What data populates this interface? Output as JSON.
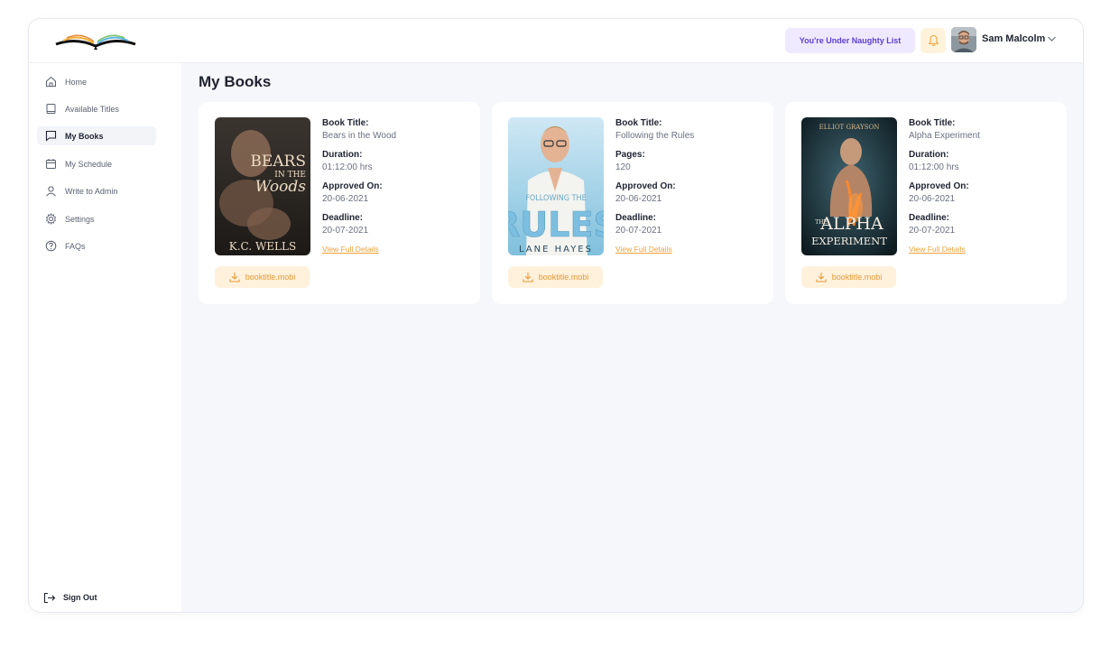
{
  "header": {
    "status_badge": "You're Under Naughty List",
    "user_name": "Sam Malcolm"
  },
  "sidebar": {
    "items": [
      {
        "label": "Home",
        "icon": "home-icon"
      },
      {
        "label": "Available Titles",
        "icon": "book-icon"
      },
      {
        "label": "My Books",
        "icon": "chat-icon",
        "active": true
      },
      {
        "label": "My Schedule",
        "icon": "calendar-icon"
      },
      {
        "label": "Write to Admin",
        "icon": "user-icon"
      },
      {
        "label": "Settings",
        "icon": "gear-icon"
      },
      {
        "label": "FAQs",
        "icon": "question-icon"
      }
    ],
    "sign_out": "Sign Out"
  },
  "main": {
    "title": "My Books",
    "books": [
      {
        "cover": {
          "line1": "BEARS",
          "line2": "IN THE",
          "line3": "Woods",
          "author": "K.C. WELLS"
        },
        "fields": [
          {
            "label": "Book Title:",
            "value": "Bears in the Wood"
          },
          {
            "label": "Duration:",
            "value": "01:12:00 hrs"
          },
          {
            "label": "Approved On:",
            "value": "20-06-2021"
          },
          {
            "label": "Deadline:",
            "value": "20-07-2021"
          }
        ],
        "link": "View Full Details",
        "file": "booktitle.mobi"
      },
      {
        "cover": {
          "line1": "FOLLOWING THE",
          "line2": "RULES",
          "author": "LANE HAYES"
        },
        "fields": [
          {
            "label": "Book Title:",
            "value": "Following the Rules"
          },
          {
            "label": "Pages:",
            "value": "120"
          },
          {
            "label": "Approved On:",
            "value": "20-06-2021"
          },
          {
            "label": "Deadline:",
            "value": "20-07-2021"
          }
        ],
        "link": "View Full Details",
        "file": "booktitle.mobi"
      },
      {
        "cover": {
          "line0": "ELLIOT GRAYSON",
          "line1": "THE",
          "line2": "ALPHA",
          "line3": "EXPERIMENT"
        },
        "fields": [
          {
            "label": "Book Title:",
            "value": "Alpha Experiment"
          },
          {
            "label": "Duration:",
            "value": "01:12:00 hrs"
          },
          {
            "label": "Approved On:",
            "value": "20-06-2021"
          },
          {
            "label": "Deadline:",
            "value": "20-07-2021"
          }
        ],
        "link": "View Full Details",
        "file": "booktitle.mobi"
      }
    ]
  },
  "colors": {
    "accent": "#f0a23a",
    "badge_bg": "#efe9ff",
    "badge_text": "#5b3fd1",
    "download_bg": "#fff1dc"
  }
}
